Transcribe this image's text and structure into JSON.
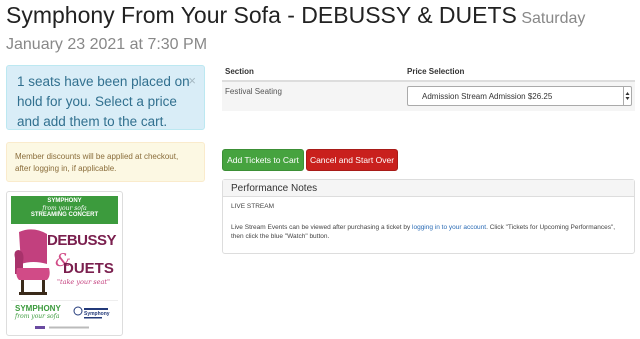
{
  "event": {
    "title": "Symphony From Your Sofa - DEBUSSY & DUETS",
    "date": "Saturday January 23 2021 at 7:30 PM"
  },
  "hold_alert": {
    "message": "1 seats have been placed on hold for you. Select a price and add them to the cart.",
    "close_glyph": "×"
  },
  "discount_alert": {
    "message": "Member discounts will be applied at checkout, after logging in, if applicable."
  },
  "poster": {
    "top_line1": "SYMPHONY",
    "top_line2": "from your sofa",
    "top_line3": "STREAMING CONCERT",
    "word1": "DEBUSSY",
    "amp": "&",
    "word2": "DUETS",
    "tagline": "\"take your seat\"",
    "symphony": "SYMPHONY",
    "symphony_sub": "from your sofa",
    "sponsor": "Symphony",
    "colors": {
      "green": "#3c9b3d",
      "magenta": "#7a1f4e",
      "pink": "#d14b87"
    }
  },
  "ticket_table": {
    "headers": {
      "section": "Section",
      "price": "Price Selection"
    },
    "rows": [
      {
        "section": "Festival Seating",
        "price_selected": "Admission Stream Admission $26.25"
      }
    ]
  },
  "buttons": {
    "add": "Add Tickets to Cart",
    "cancel": "Cancel and Start Over",
    "colors": {
      "add": "#46a33f",
      "cancel": "#c9201d"
    }
  },
  "notes": {
    "header": "Performance Notes",
    "live_stream": "LIVE STREAM",
    "text_before": "Live Stream Events can be viewed after purchasing a ticket by ",
    "link": "logging in to your account",
    "text_after": ". Click \"Tickets for Upcoming Performances\", then click the blue \"Watch\" button."
  }
}
